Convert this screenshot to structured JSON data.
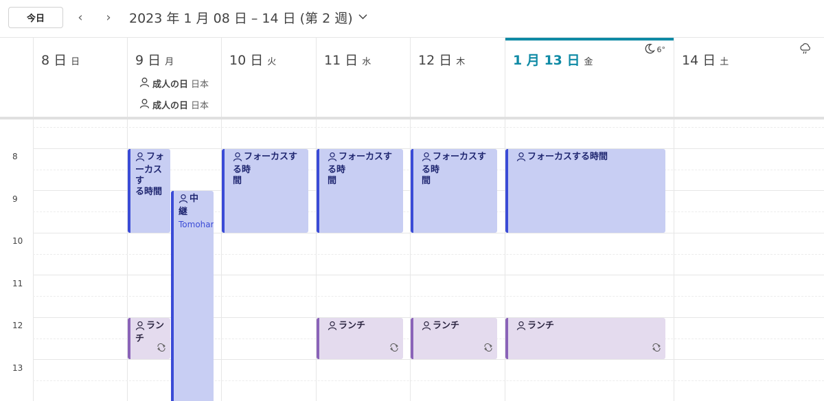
{
  "toolbar": {
    "today_label": "今日",
    "prev_icon": "chevron-left-icon",
    "next_icon": "chevron-right-icon",
    "date_range": "2023 年 1 月 08 日 – 14 日 (第 2 週)"
  },
  "days": [
    {
      "label": "8 日",
      "weekday": "日"
    },
    {
      "label": "9 日",
      "weekday": "月"
    },
    {
      "label": "10 日",
      "weekday": "火"
    },
    {
      "label": "11 日",
      "weekday": "水"
    },
    {
      "label": "12 日",
      "weekday": "木"
    },
    {
      "label": "1 月 13 日",
      "weekday": "金"
    },
    {
      "label": "14 日",
      "weekday": "土"
    }
  ],
  "weather": {
    "friday": {
      "icon": "moon-icon",
      "temp": "6°"
    },
    "saturday": {
      "icon": "cloud-rain-icon"
    }
  },
  "all_day_events": [
    {
      "title": "成人の日",
      "sub": "日本"
    },
    {
      "title": "成人の日",
      "sub": "日本"
    }
  ],
  "time_labels": [
    "8",
    "9",
    "10",
    "11",
    "12",
    "13"
  ],
  "events": {
    "focus_title": "フォーカスする時間",
    "focus_mon_lines": [
      "フォ",
      "ーカスす",
      "る時間"
    ],
    "focus_split_lines": [
      "フォーカスする時",
      "間"
    ],
    "relay_lines": [
      "中",
      "継"
    ],
    "relay_sub": "Tomohar",
    "lunch_title": "ランチ",
    "lunch_mon_lines": [
      "ラン",
      "チ"
    ]
  },
  "colors": {
    "accent_today": "#0f8aa5",
    "focus_bg": "#c8cef3",
    "focus_bar": "#3a4bd6",
    "lunch_bg": "#e4dbee",
    "lunch_bar": "#8a63b8"
  }
}
